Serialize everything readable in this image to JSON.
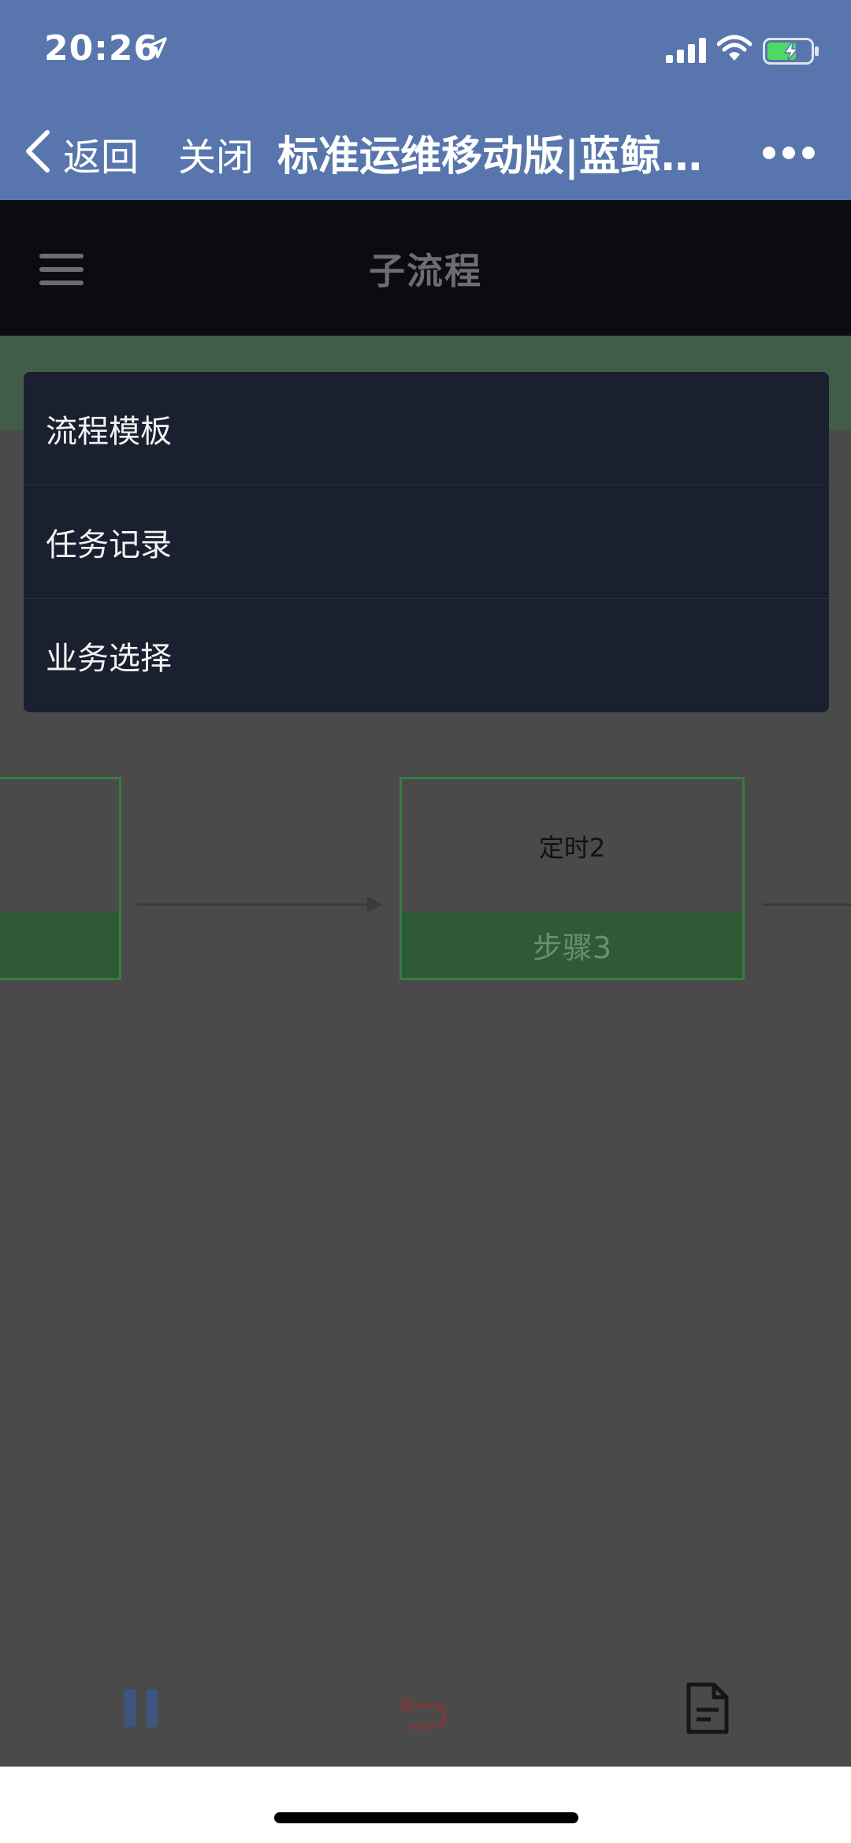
{
  "status_bar": {
    "time": "20:26"
  },
  "nav": {
    "back_label": "返回",
    "close_label": "关闭",
    "title": "标准运维移动版|蓝鲸…"
  },
  "app_bar": {
    "title": "子流程"
  },
  "dropdown": {
    "items": [
      {
        "label": "流程模板"
      },
      {
        "label": "任务记录"
      },
      {
        "label": "业务选择"
      }
    ]
  },
  "flow": {
    "nodes": [
      {
        "name": "",
        "step": ""
      },
      {
        "name": "定时2",
        "step": "步骤3"
      }
    ]
  },
  "colors": {
    "nav_bg": "#5876ad",
    "appbar_bg": "#0a0c12",
    "node_border": "#3b7a45",
    "node_step_bg": "#2e5a36",
    "dropdown_bg": "#1a2030"
  }
}
